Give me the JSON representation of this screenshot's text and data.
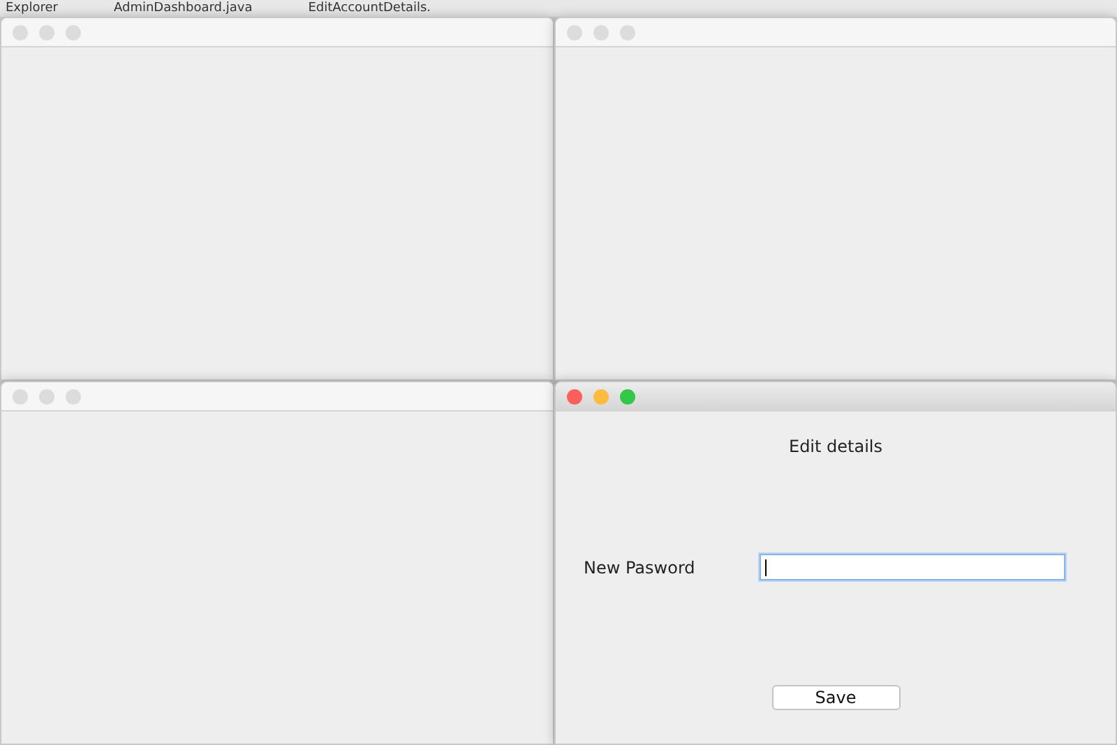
{
  "ide_tabs": [
    {
      "label": "Explorer"
    },
    {
      "label": "AdminDashboard.java"
    },
    {
      "label": "EditAccountDetails."
    }
  ],
  "windows": [
    {
      "active": false
    },
    {
      "active": false
    },
    {
      "active": false
    },
    {
      "active": true,
      "heading": "Edit details",
      "field": {
        "label": "New Pasword",
        "focused": true
      },
      "button": "Save"
    }
  ]
}
